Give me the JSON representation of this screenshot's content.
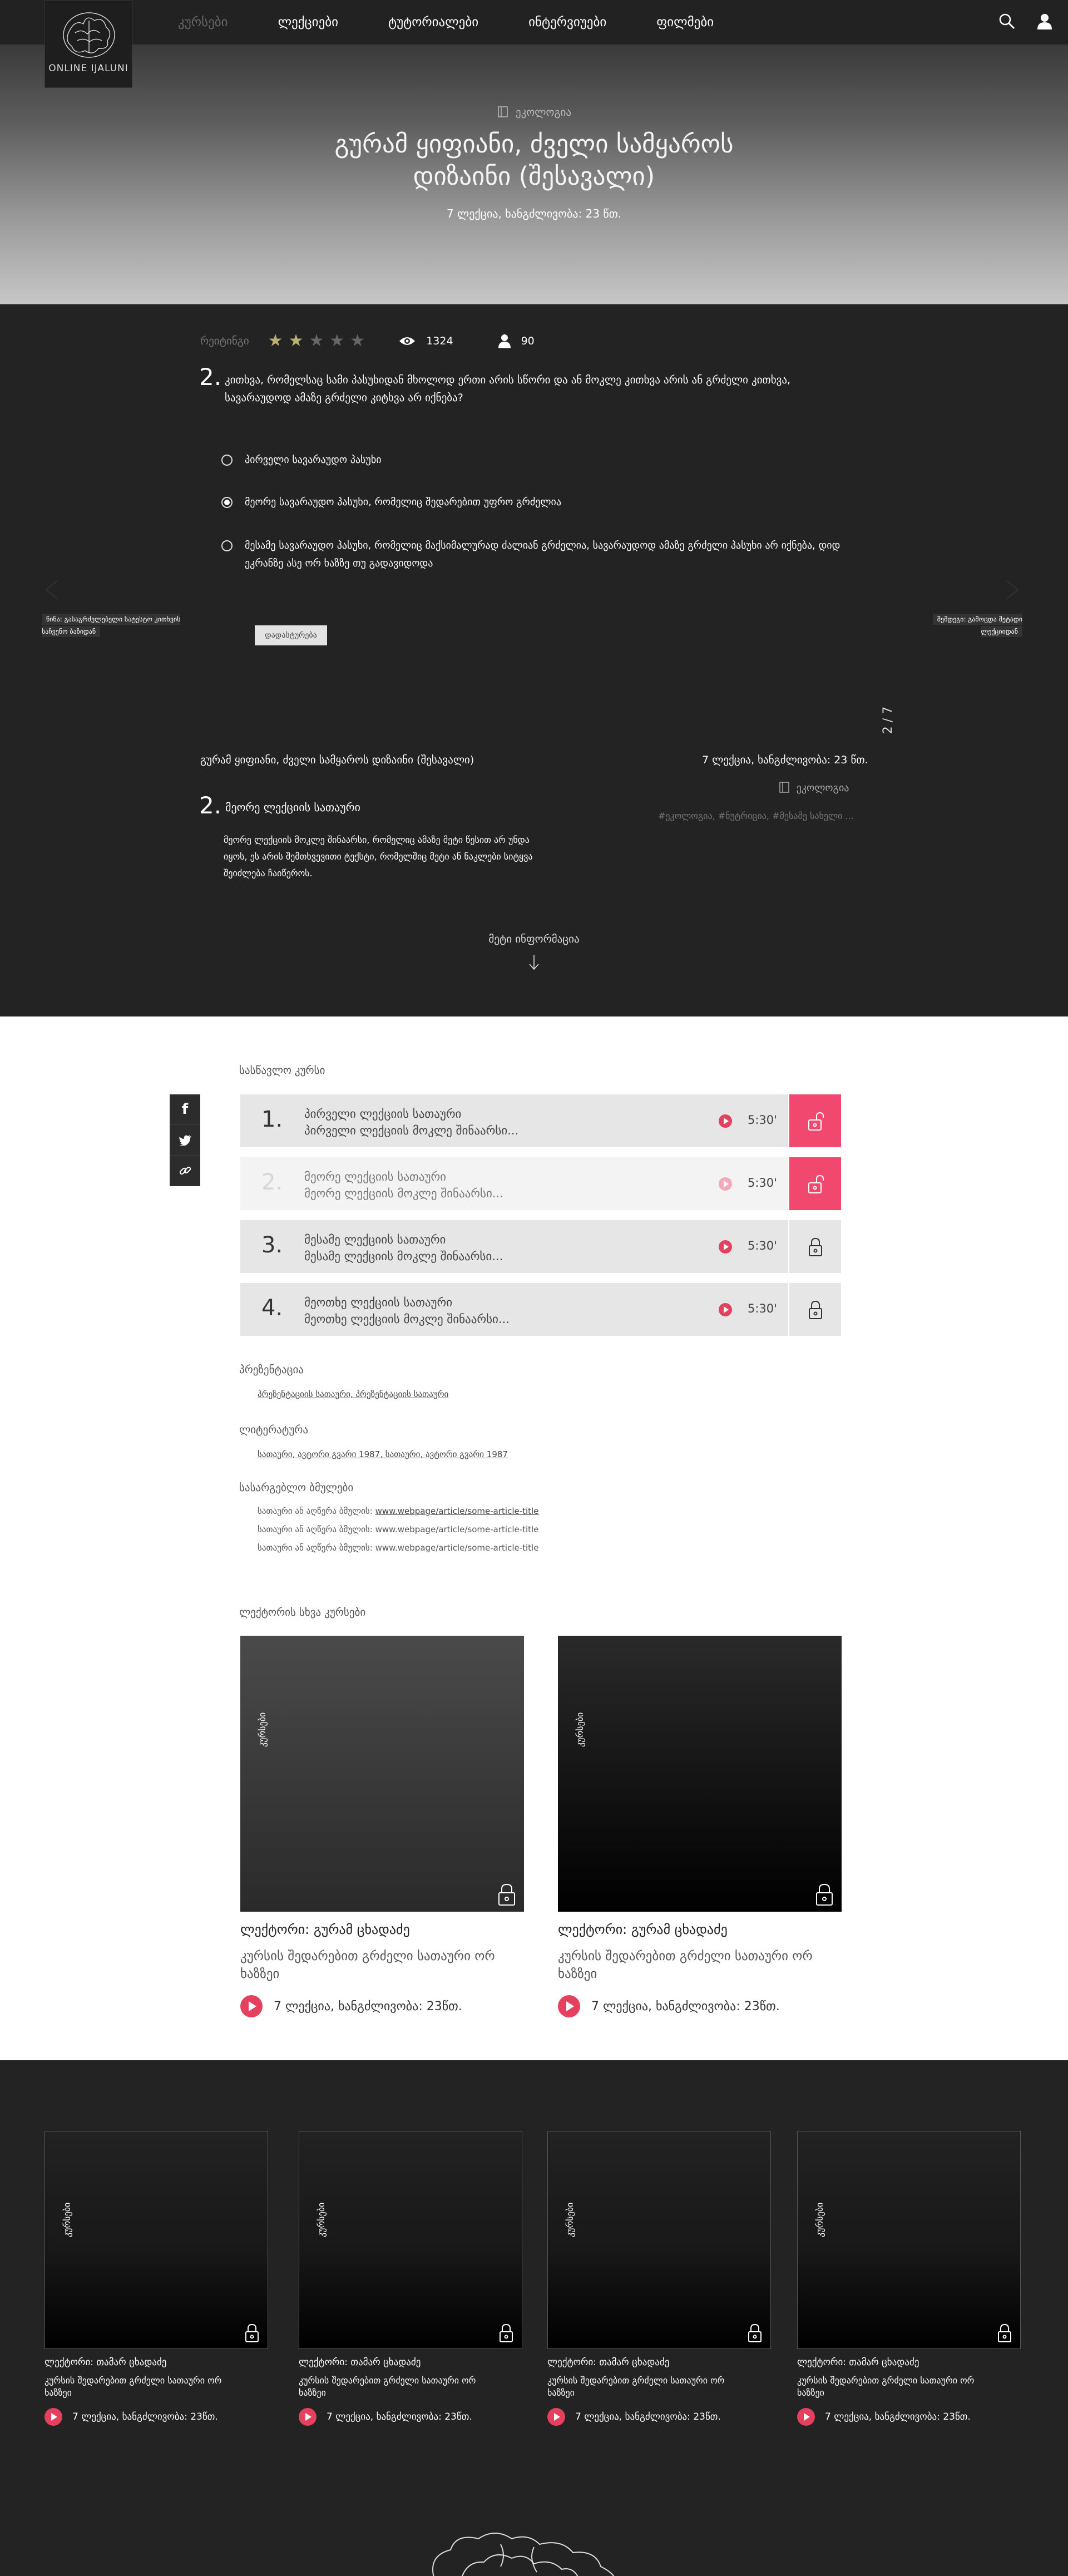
{
  "nav": {
    "logo_text": "ONLINE IJALUNI",
    "items": [
      {
        "label": "კურსები",
        "active": false
      },
      {
        "label": "ლექციები",
        "active": true
      },
      {
        "label": "ტუტორიალები",
        "active": true
      },
      {
        "label": "ინტერვიუები",
        "active": true
      },
      {
        "label": "ფილმები",
        "active": true
      }
    ],
    "icons": [
      "search-icon",
      "user-icon"
    ]
  },
  "hero": {
    "category": "ეკოლოგია",
    "title": "გურამ ყიფიანი, ძველი სამყაროს დიზაინი (შესავალი)",
    "meta": "7 ლექცია, ხანგძლივობა: 23 წთ."
  },
  "quiz": {
    "rating_label": "რეიტინგი",
    "rating": 2,
    "rating_max": 5,
    "views": "1324",
    "users": "90",
    "number": "2.",
    "question": "კითხვა, რომელსაც სამი პასუხიდან მხოლოდ ერთი არის სწორი და ან მოკლე კითხვა არის ან გრძელი კითხვა, სავარაუდოდ ამაზე გრძელი კიტხვა არ იქნება?",
    "options": [
      {
        "label": "პირველი სავარაუდო პასუხი",
        "checked": false
      },
      {
        "label": "მეორე სავარაუდო პასუხი, რომელიც შედარებით უფრო გრძელია",
        "checked": true
      },
      {
        "label": "მესამე სავარაუდო პასუხი, რომელიც მაქსიმალურად ძალიან გრძელია, სავარაუდოდ ამაზე გრძელი პასუხი არ იქნება, დიდ ეკრანზე ასე ორ ხაზზე თუ გადავიდოდა",
        "checked": false
      }
    ],
    "submit_label": "დადასტურება",
    "prev_label": "წინა: გასაგრძელებელი სატესტო კითხვის საჩვენო ბაზიდან",
    "next_label": "შემდეგი: გამოცდა მეტადი ლექციიდან",
    "pager": "2 / 7"
  },
  "next_lecture": {
    "course": "გურამ ყიფიანი, ძველი სამყაროს დიზაინი (შესავალი)",
    "meta": "7 ლექცია, ხანგძლივობა: 23 წთ.",
    "category": "ეკოლოგია",
    "tags": "#ეკოლოგია, #ნუტრიცია, #მესამე სახელი ...",
    "number": "2.",
    "title": "მეორე ლექციის სათაური",
    "description": "მეორე ლექციის მოკლე შინაარსი, რომელიც ამაზე მეტი წესით არ უნდა იყოს, ეს არის შემთხვევითი ტექსტი, რომელშიც მეტი ან ნაკლები სიტყვა შეიძლება ჩაიწეროს.",
    "more_info": "მეტი ინფორმაცია"
  },
  "content": {
    "course_title": "სასწავლო კურსი",
    "lectures": [
      {
        "number": "1.",
        "title": "პირველი ლექციის სათაური",
        "summary": "პირველი ლექციის მოკლე შინაარსი...",
        "duration": "5:30'",
        "locked": false,
        "faded": false
      },
      {
        "number": "2.",
        "title": "მეორე ლექციის სათაური",
        "summary": "მეორე ლექციის მოკლე შინაარსი...",
        "duration": "5:30'",
        "locked": false,
        "faded": true
      },
      {
        "number": "3.",
        "title": "მესამე ლექციის სათაური",
        "summary": "მესამე ლექციის მოკლე შინაარსი...",
        "duration": "5:30'",
        "locked": true,
        "faded": false
      },
      {
        "number": "4.",
        "title": "მეოთხე ლექციის სათაური",
        "summary": "მეოთხე ლექციის მოკლე შინაარსი...",
        "duration": "5:30'",
        "locked": true,
        "faded": false
      }
    ],
    "presentation_title": "პრეზენტაცია",
    "presentation_items": "პრეზენტაციის სათაური,  პრეზენტაციის სათაური",
    "literature_title": "ლიტერატურა",
    "literature_items": "სათაური, ავტორი გვარი 1987,  სათაური, ავტორი გვარი 1987",
    "links_title": "სასარგებლო ბმულები",
    "links": [
      {
        "label": "სათაური ან აღწერა ბმულის:",
        "url": "www.webpage/article/some-article-title"
      },
      {
        "label": "სათაური ან აღწერა ბმულის:",
        "url": "www.webpage/article/some-article-title"
      },
      {
        "label": "სათაური ან აღწერა ბმულის:",
        "url": "www.webpage/article/some-article-title"
      }
    ],
    "other_courses_title": "ლექტორის სხვა კურსები",
    "cards": [
      {
        "tag": "კურსები",
        "lecturer": "ლექტორი: გურამ ცხადაძე",
        "title": "კურსის შედარებით გრძელი სათაური ორ ხაზზეი",
        "meta": "7 ლექცია, ხანგძლივობა: 23წთ."
      },
      {
        "tag": "კურსები",
        "lecturer": "ლექტორი: გურამ ცხადაძე",
        "title": "კურსის შედარებით გრძელი სათაური ორ ხაზზეი",
        "meta": "7 ლექცია, ხანგძლივობა: 23წთ."
      }
    ]
  },
  "bottom": {
    "cards": [
      {
        "tag": "კურსები",
        "lecturer": "ლექტორი: თამარ ცხადაძე",
        "title": "კურსის შედარებით გრძელი სათაური ორ ხაზზეი",
        "meta": "7 ლექცია, ხანგძლივობა: 23წთ."
      },
      {
        "tag": "კურსები",
        "lecturer": "ლექტორი: თამარ ცხადაძე",
        "title": "კურსის შედარებით გრძელი სათაური ორ ხაზზეი",
        "meta": "7 ლექცია, ხანგძლივობა: 23წთ."
      },
      {
        "tag": "კურსები",
        "lecturer": "ლექტორი: თამარ ცხადაძე",
        "title": "კურსის შედარებით გრძელი სათაური ორ ხაზზეი",
        "meta": "7 ლექცია, ხანგძლივობა: 23წთ."
      },
      {
        "tag": "კურსები",
        "lecturer": "ლექტორი: თამარ ცხადაძე",
        "title": "კურსის შედარებით გრძელი სათაური ორ ხაზზეი",
        "meta": "7 ლექცია, ხანგძლივობა: 23წთ."
      }
    ]
  },
  "colors": {
    "accent": "#f0486e",
    "dark": "#232323",
    "star": "#b8b173"
  }
}
